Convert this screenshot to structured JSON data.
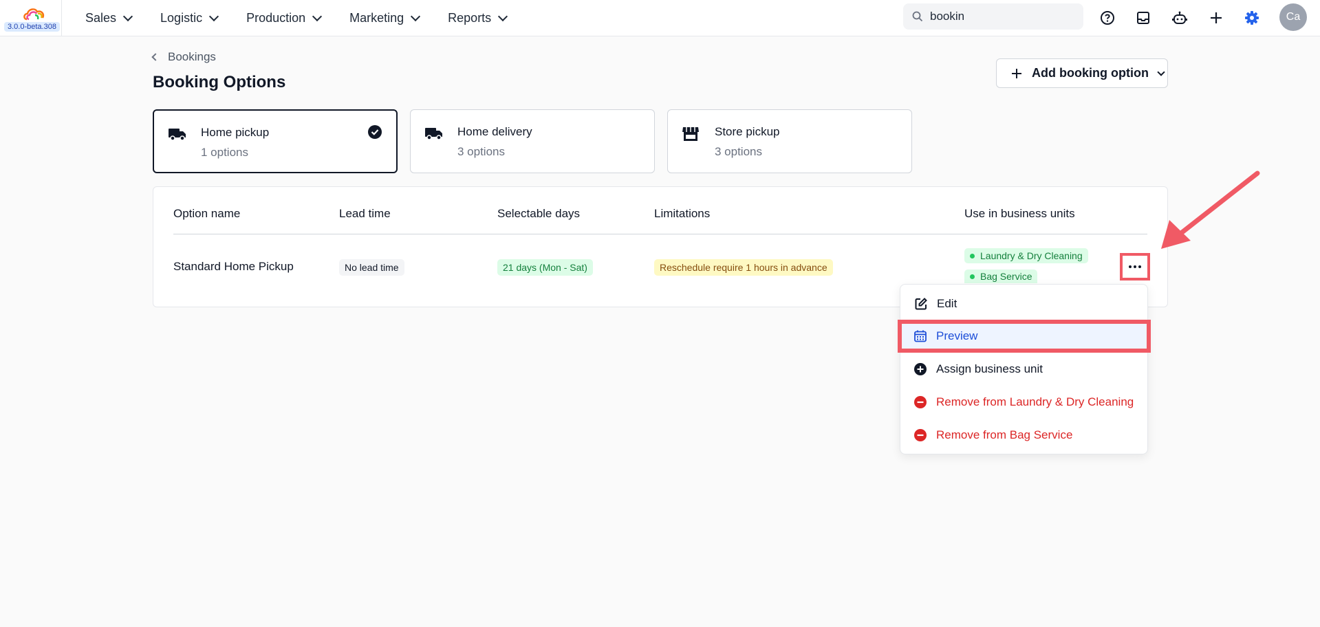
{
  "app": {
    "version": "3.0.0-beta.308"
  },
  "nav": {
    "items": [
      {
        "label": "Sales"
      },
      {
        "label": "Logistic"
      },
      {
        "label": "Production"
      },
      {
        "label": "Marketing"
      },
      {
        "label": "Reports"
      }
    ]
  },
  "search": {
    "value": "bookin"
  },
  "user": {
    "initials": "Ca"
  },
  "header": {
    "breadcrumb": "Bookings",
    "title": "Booking Options",
    "add_button": "Add booking option"
  },
  "cards": [
    {
      "title": "Home pickup",
      "subtitle": "1 options",
      "icon": "truck-icon",
      "selected": true
    },
    {
      "title": "Home delivery",
      "subtitle": "3 options",
      "icon": "truck-icon",
      "selected": false
    },
    {
      "title": "Store pickup",
      "subtitle": "3 options",
      "icon": "store-icon",
      "selected": false
    }
  ],
  "table": {
    "headers": {
      "name": "Option name",
      "lead_time": "Lead time",
      "days": "Selectable days",
      "limitations": "Limitations",
      "units": "Use in business units"
    },
    "rows": [
      {
        "name": "Standard Home Pickup",
        "lead_time": "No lead time",
        "days": "21 days (Mon - Sat)",
        "limitation": "Reschedule require 1 hours in advance",
        "units": [
          "Laundry & Dry Cleaning",
          "Bag Service"
        ]
      }
    ]
  },
  "menu": {
    "items": [
      {
        "label": "Edit",
        "icon": "edit-icon"
      },
      {
        "label": "Preview",
        "icon": "calendar-icon"
      },
      {
        "label": "Assign business unit",
        "icon": "plus-circle-icon"
      },
      {
        "label": "Remove from Laundry & Dry Cleaning",
        "icon": "minus-circle-icon"
      },
      {
        "label": "Remove from Bag Service",
        "icon": "minus-circle-icon"
      }
    ]
  },
  "colors": {
    "accent": "#1d4ed8",
    "highlight": "#f05a65",
    "danger": "#dc2626",
    "success": "#15803d"
  }
}
